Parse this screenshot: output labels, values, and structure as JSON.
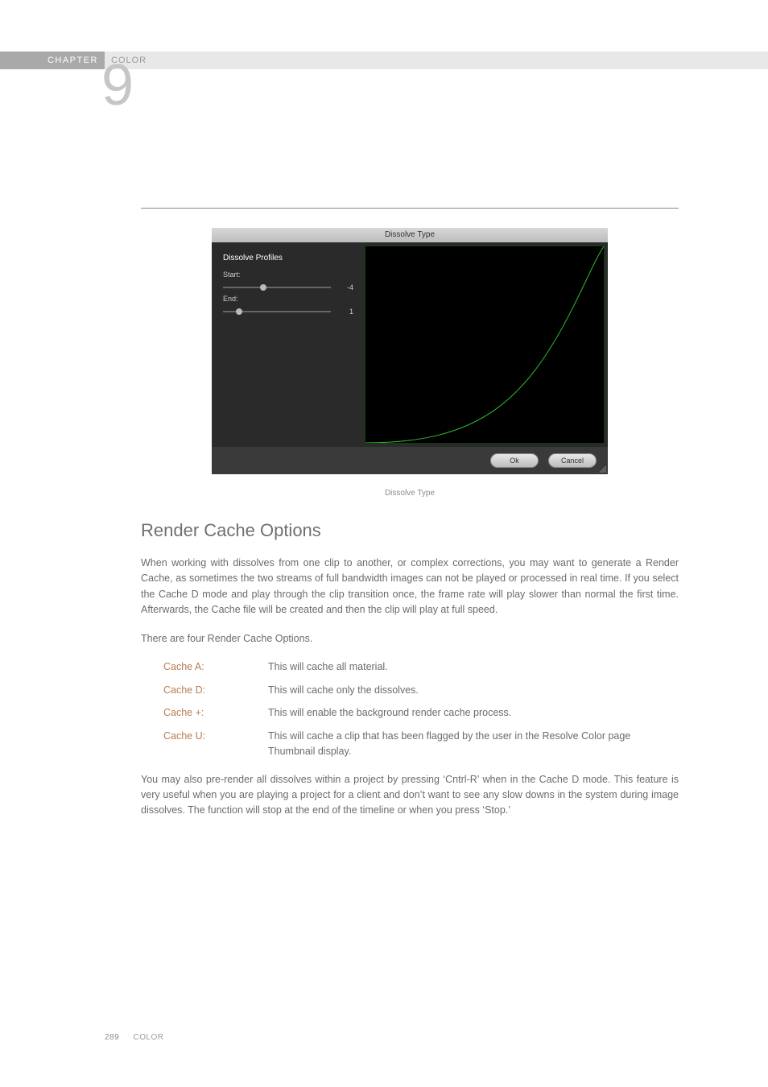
{
  "header": {
    "chapter_label": "CHAPTER",
    "chapter_title": "COLOR",
    "chapter_number": "9"
  },
  "dialog": {
    "title": "Dissolve Type",
    "profiles_label": "Dissolve Profiles",
    "start_label": "Start:",
    "start_value": "-4",
    "end_label": "End:",
    "end_value": "1",
    "ok_label": "Ok",
    "cancel_label": "Cancel"
  },
  "caption": "Dissolve Type",
  "section_heading": "Render Cache Options",
  "para1": "When working with dissolves from one clip to another, or complex corrections, you may want to generate a Render Cache, as sometimes the two streams of full bandwidth images can not be played or processed in real time. If you select the Cache D mode and play through the clip transition once, the frame rate will play slower than normal the first time. Afterwards, the Cache file will be created and then the clip will play at full speed.",
  "para2": "There are four Render Cache Options.",
  "options": [
    {
      "key": "Cache A:",
      "val": "This will cache all material."
    },
    {
      "key": "Cache D:",
      "val": "This will cache only the dissolves."
    },
    {
      "key": "Cache +:",
      "val": "This will enable the background render cache process."
    },
    {
      "key": "Cache U:",
      "val": "This will cache a clip that has been flagged by the user in the Resolve Color page Thumbnail display."
    }
  ],
  "para3": "You may also pre-render all dissolves within a project by pressing ‘Cntrl-R’ when in the Cache D mode. This feature is very useful when you are playing a project for a client and don’t want to see any slow downs in the system during image dissolves. The function will stop at the end of the timeline or when you press ‘Stop.’",
  "footer": {
    "page": "289",
    "label": "COLOR"
  },
  "chart_data": {
    "type": "line",
    "title": "Dissolve Type",
    "xlabel": "",
    "ylabel": "",
    "xlim": [
      0,
      1
    ],
    "ylim": [
      0,
      1
    ],
    "series": [
      {
        "name": "dissolve-curve",
        "x": [
          0.0,
          0.3,
          0.5,
          0.7,
          0.85,
          1.0
        ],
        "values": [
          0.0,
          0.05,
          0.18,
          0.42,
          0.7,
          1.0
        ]
      }
    ]
  }
}
